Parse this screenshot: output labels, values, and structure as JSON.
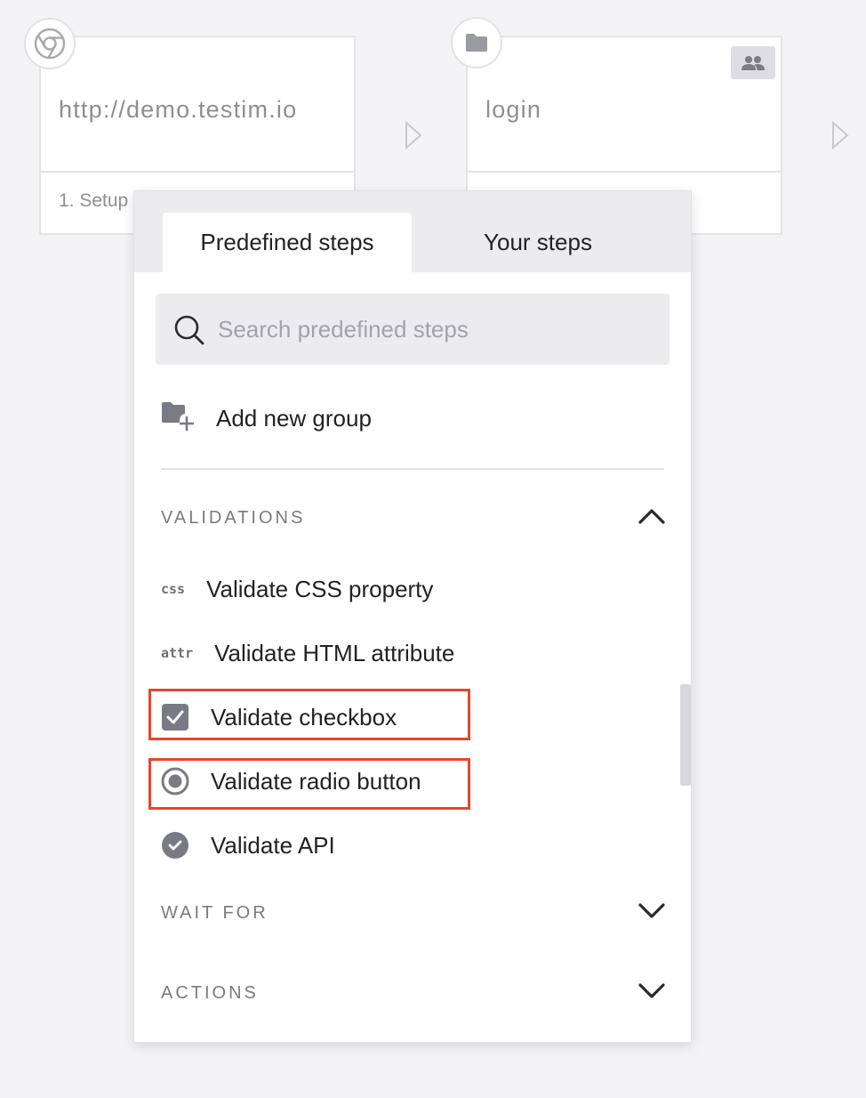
{
  "steps": [
    {
      "title": "http://demo.testim.io",
      "subtitle": "1. Setup",
      "icon": "chrome-icon"
    },
    {
      "title": "login",
      "subtitle": "",
      "icon": "folder-icon",
      "badge_icon": "people-icon"
    }
  ],
  "panel": {
    "tabs": [
      {
        "label": "Predefined steps",
        "active": true
      },
      {
        "label": "Your steps",
        "active": false
      }
    ],
    "search": {
      "placeholder": "Search predefined steps",
      "value": ""
    },
    "add_group": {
      "label": "Add new group",
      "icon": "folder-plus-icon"
    },
    "sections": {
      "validations": {
        "title": "VALIDATIONS",
        "expanded": true,
        "items": [
          {
            "tag": "css",
            "label": "Validate CSS property"
          },
          {
            "tag": "attr",
            "label": "Validate HTML attribute"
          },
          {
            "icon": "checkbox-icon",
            "label": "Validate checkbox",
            "highlighted": true
          },
          {
            "icon": "radio-icon",
            "label": "Validate radio button",
            "highlighted": true
          },
          {
            "icon": "check-circle-icon",
            "label": "Validate API"
          }
        ]
      },
      "wait_for": {
        "title": "WAIT FOR",
        "expanded": false
      },
      "actions": {
        "title": "ACTIONS",
        "expanded": false
      }
    }
  },
  "colors": {
    "highlight": "#e8452c",
    "icon_gray": "#7a7a84",
    "tab_bar": "#ececef"
  }
}
